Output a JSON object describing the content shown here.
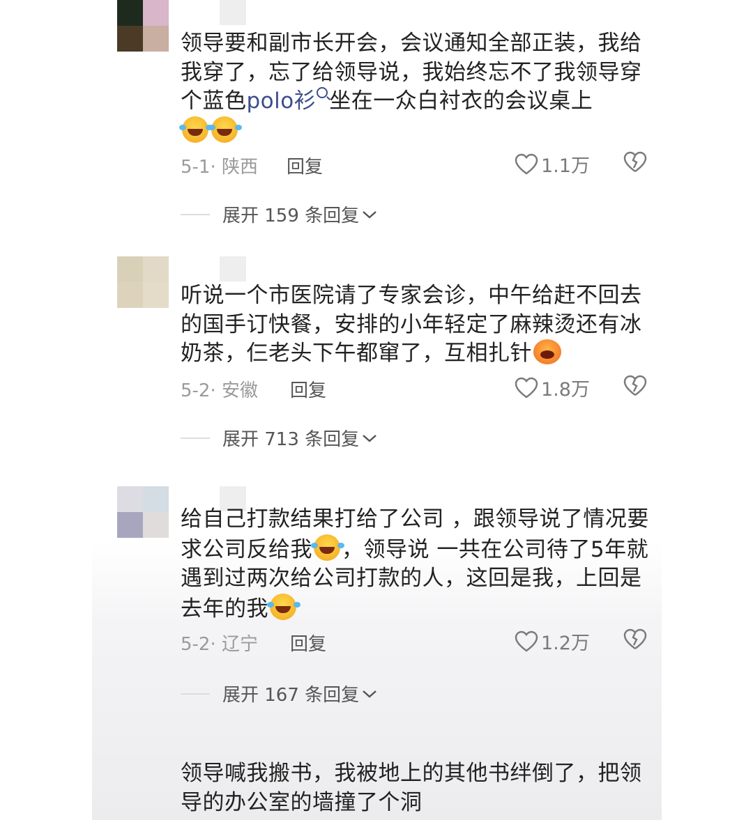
{
  "colors": {
    "link": "#3c4e8c",
    "text": "#222222",
    "meta": "#9a9a9a",
    "reply": "#555555"
  },
  "comments": [
    {
      "text_before": "领导要和副市长开会，会议通知全部正装，我给我穿了，忘了给领导说，我始终忘不了我领导穿个蓝色",
      "link": "polo衫",
      "text_after": "坐在一众白衬衣的会议桌上",
      "emoji": "grinning-squinting-tears",
      "date_location": "5-1· 陕西",
      "reply_label": "回复",
      "likes": "1.1万",
      "expand_label": "展开 159 条回复"
    },
    {
      "text": "听说一个市医院请了专家会诊，中午给赶不回去的国手订快餐，安排的小年轻定了麻辣烫还有冰奶茶，仨老头下午都窜了，互相扎针",
      "emoji": "yawning-face",
      "date_location": "5-2· 安徽",
      "reply_label": "回复",
      "likes": "1.8万",
      "expand_label": "展开 713 条回复"
    },
    {
      "text_a": "给自己打款结果打给了公司 ，跟领导说了情况要求公司反给我",
      "text_b": "，领导说 一共在公司待了5年就遇到过两次给公司打款的人，这回是我，上回是去年的我",
      "emoji": "grinning-squinting-tears",
      "date_location": "5-2· 辽宁",
      "reply_label": "回复",
      "likes": "1.2万",
      "expand_label": "展开 167 条回复"
    },
    {
      "text": "领导喊我搬书，我被地上的其他书绊倒了，把领导的办公室的墙撞了个洞"
    }
  ]
}
